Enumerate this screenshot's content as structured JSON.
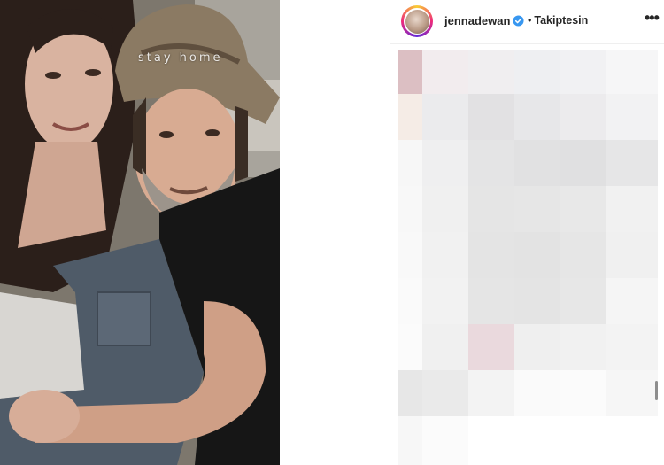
{
  "photo": {
    "overlay_text": "stay home"
  },
  "post": {
    "username": "jennadewan",
    "verified": true,
    "follow_status": "Takiptesin",
    "more_icon": "more-options-icon",
    "accent_color": "#3897f0"
  }
}
